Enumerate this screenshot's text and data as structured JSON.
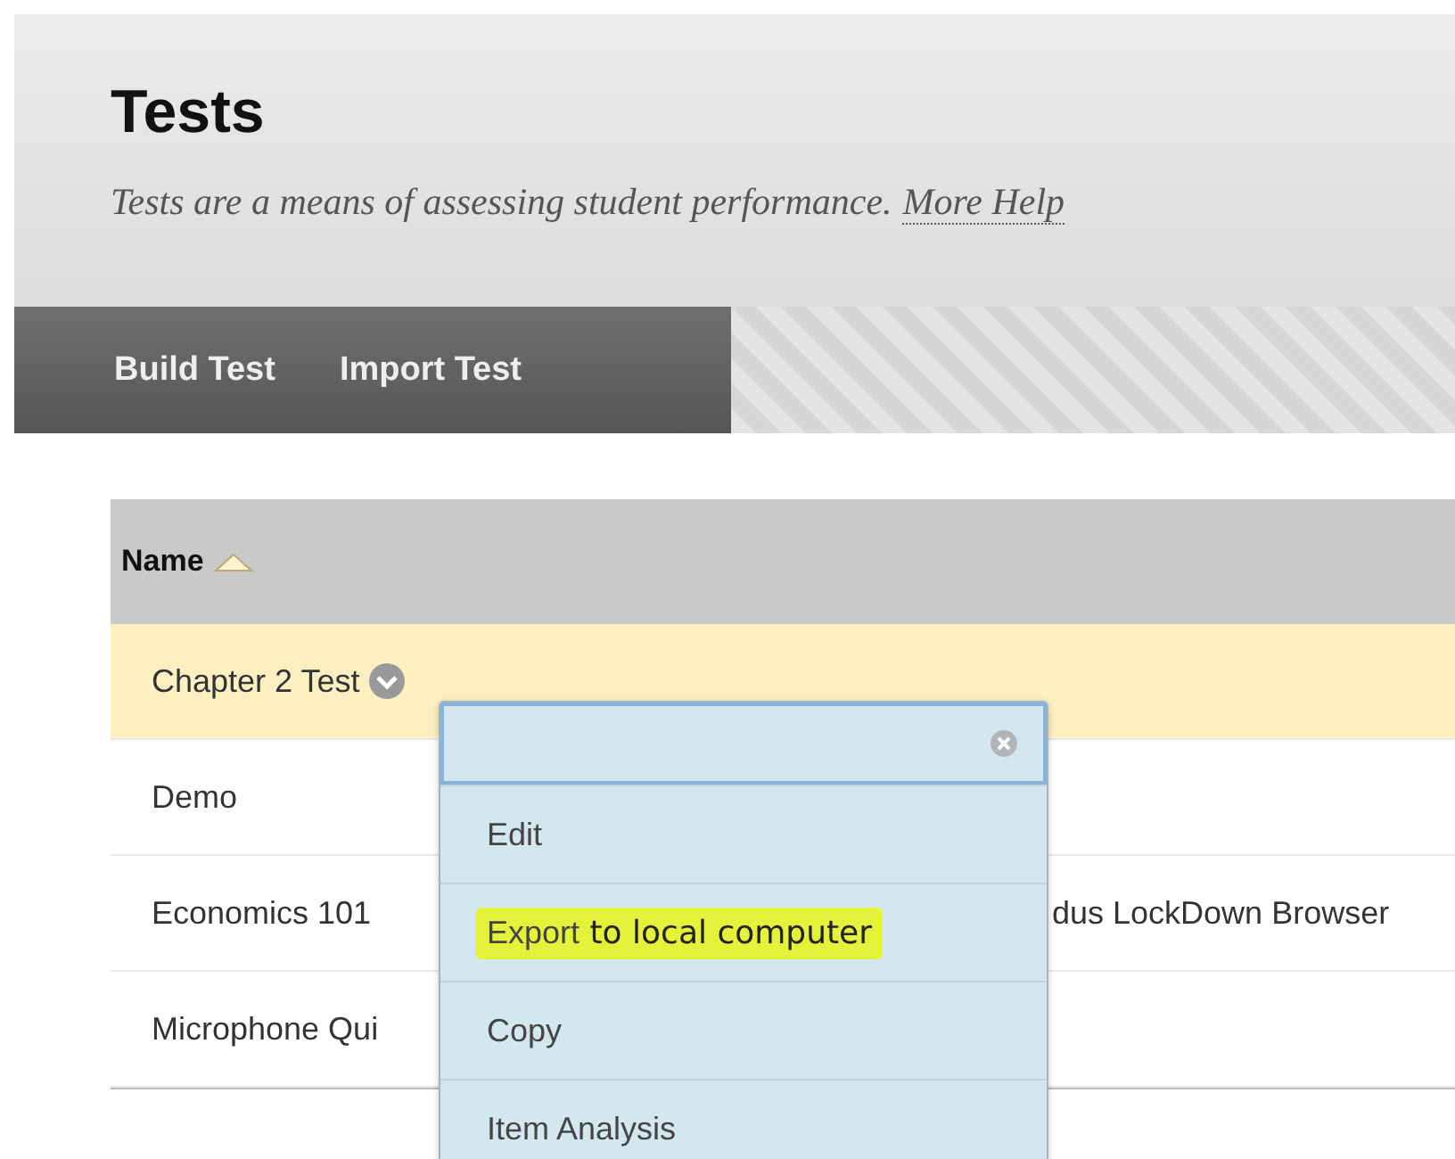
{
  "header": {
    "title": "Tests",
    "description": "Tests are a means of assessing student performance.",
    "help_link": "More Help"
  },
  "actions": [
    "Build Test",
    "Import Test"
  ],
  "table": {
    "columns": [
      {
        "label": "Name",
        "sorted": true
      }
    ],
    "rows": [
      {
        "name": "Chapter 2 Test",
        "selected": true,
        "menu_button": true
      },
      {
        "name": "Demo",
        "selected": false,
        "menu_button": false
      },
      {
        "name": "Economics 101",
        "extra": "dus LockDown Browser",
        "selected": false,
        "menu_button": false
      },
      {
        "name": "Microphone Qui",
        "selected": false,
        "menu_button": false
      }
    ]
  },
  "context_menu": {
    "items": [
      {
        "label": "Edit",
        "highlighted": false
      },
      {
        "label": "Export",
        "note": "to local computer",
        "highlighted": true
      },
      {
        "label": "Copy",
        "highlighted": false
      },
      {
        "label": "Item Analysis",
        "highlighted": false
      }
    ]
  }
}
